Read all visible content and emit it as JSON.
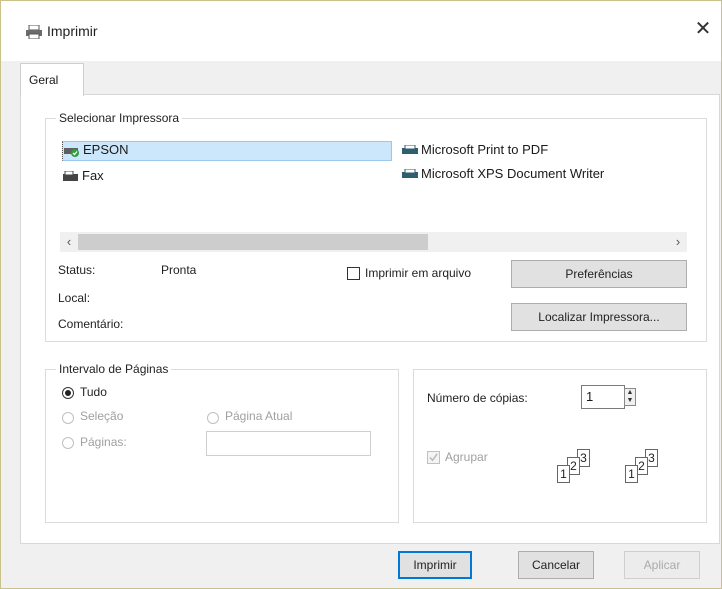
{
  "window": {
    "title": "Imprimir",
    "close_glyph": "✕"
  },
  "tabs": [
    {
      "label": "Geral"
    }
  ],
  "select_printer": {
    "group_label": "Selecionar Impressora",
    "printers": [
      {
        "name": "EPSON",
        "icon": "printer-default-icon"
      },
      {
        "name": "Fax",
        "icon": "fax-icon"
      },
      {
        "name": "Microsoft Print to PDF",
        "icon": "printer-icon"
      },
      {
        "name": "Microsoft XPS Document Writer",
        "icon": "printer-icon"
      }
    ],
    "selected": "EPSON",
    "scroll_left": "‹",
    "scroll_right": "›",
    "status_label": "Status:",
    "status_value": "Pronta",
    "location_label": "Local:",
    "comment_label": "Comentário:",
    "print_to_file_label": "Imprimir em arquivo",
    "preferences_button": "Preferências",
    "find_printer_button": "Localizar Impressora..."
  },
  "page_range": {
    "group_label": "Intervalo de Páginas",
    "all_label": "Tudo",
    "selection_label": "Seleção",
    "current_page_label": "Página Atual",
    "pages_label": "Páginas:",
    "pages_value": "",
    "selected_option": "Tudo"
  },
  "copies": {
    "label": "Número de cópias:",
    "value": "1",
    "collate_label": "Agrupar",
    "collate_pages": [
      "1",
      "2",
      "3"
    ]
  },
  "footer": {
    "print_button": "Imprimir",
    "cancel_button": "Cancelar",
    "apply_button": "Aplicar"
  }
}
